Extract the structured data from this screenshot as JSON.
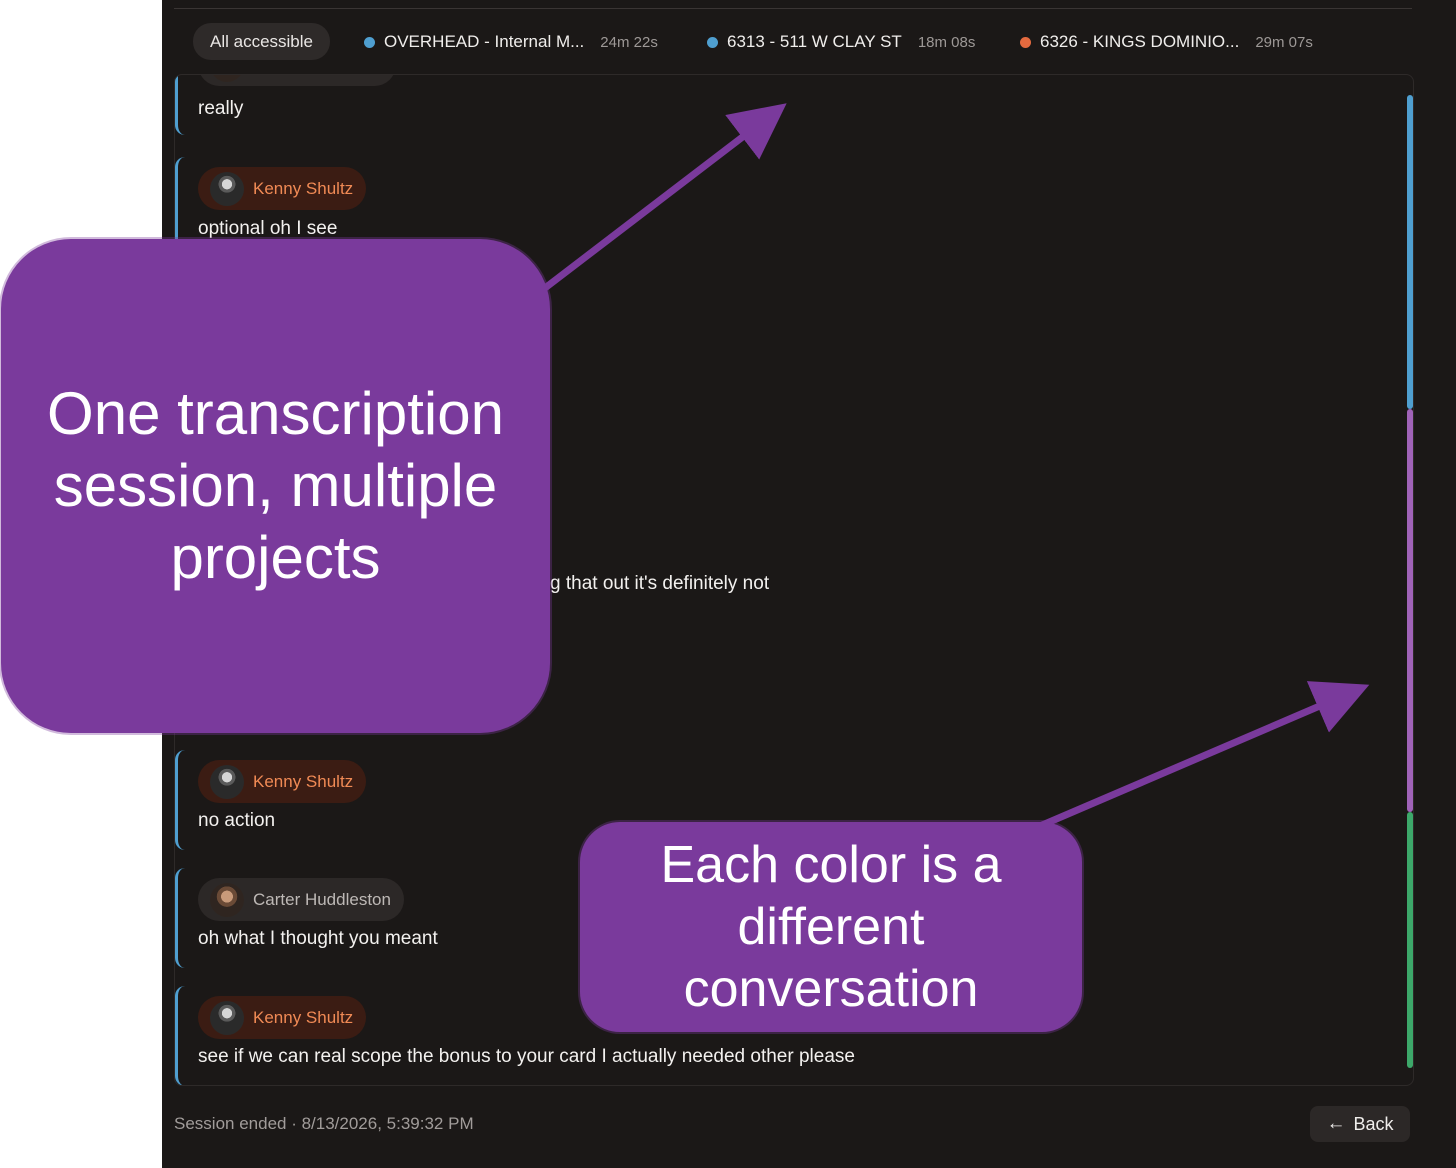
{
  "tabs": {
    "all_label": "All accessible",
    "items": [
      {
        "label": "OVERHEAD - Internal M...",
        "duration": "24m 22s",
        "dot_color": "#4f9fd0"
      },
      {
        "label": "6313 - 511 W CLAY ST",
        "duration": "18m 08s",
        "dot_color": "#4f9fd0"
      },
      {
        "label": "6326 - KINGS DOMINIO...",
        "duration": "29m 07s",
        "dot_color": "#e46a3f"
      }
    ]
  },
  "messages": [
    {
      "speaker": "",
      "text": "really"
    },
    {
      "speaker": "Kenny Shultz",
      "text": "optional oh I see"
    },
    {
      "speaker": "",
      "text": "g that out it's definitely not"
    },
    {
      "speaker": "Kenny Shultz",
      "text": "no action"
    },
    {
      "speaker": "Carter Huddleston",
      "text": "oh what I thought you meant"
    },
    {
      "speaker": "Kenny Shultz",
      "text": "see if we can real scope the bonus to your card I actually needed other please"
    }
  ],
  "conversation_rail": {
    "colors": [
      "#4f9fd0",
      "#a063b8",
      "#3da86a"
    ]
  },
  "footer": {
    "status": "Session ended · 8/13/2026, 5:39:32 PM",
    "back_label": "Back"
  },
  "annotations": {
    "callout_1": "One transcription session, multiple projects",
    "callout_2": "Each color is a different conversation",
    "color": "#7a3a9c"
  }
}
